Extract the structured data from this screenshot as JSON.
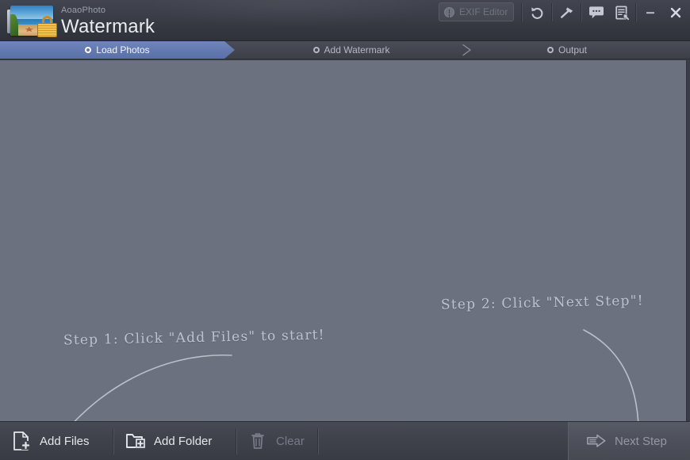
{
  "app": {
    "brand_small": "AoaoPhoto",
    "brand_big": "Watermark",
    "logo_icon": "photo-with-padlock-logo"
  },
  "titlebar": {
    "exif_button": {
      "label": "EXIF Editor",
      "icon": "exclamation-circle-icon",
      "enabled": false
    },
    "tools": [
      {
        "name": "undo-icon",
        "tooltip": "Undo"
      },
      {
        "name": "tools-hammer-icon",
        "tooltip": "Tools"
      },
      {
        "name": "feedback-bubble-icon",
        "tooltip": "Feedback"
      },
      {
        "name": "register-document-icon",
        "tooltip": "Register"
      }
    ],
    "window_controls": [
      {
        "name": "minimize-icon",
        "glyph": "minimize"
      },
      {
        "name": "close-icon",
        "glyph": "close"
      }
    ]
  },
  "steps": {
    "active_index": 0,
    "items": [
      {
        "label": "Load Photos",
        "state": "active"
      },
      {
        "label": "Add Watermark",
        "state": "inactive"
      },
      {
        "label": "Output",
        "state": "inactive"
      }
    ]
  },
  "canvas": {
    "background_color": "#6c7180",
    "annotations": [
      {
        "id": "step1",
        "text": "Step 1: Click \"Add Files\" to start!",
        "arrow": "curved-arrow-down-left"
      },
      {
        "id": "step2",
        "text": "Step 2: Click \"Next Step\"!",
        "arrow": "curved-arrow-down-right"
      }
    ],
    "empty": true
  },
  "bottombar": {
    "buttons": [
      {
        "label": "Add Files",
        "icon": "file-add-icon",
        "enabled": true
      },
      {
        "label": "Add Folder",
        "icon": "folder-add-icon",
        "enabled": true
      },
      {
        "label": "Clear",
        "icon": "trash-icon",
        "enabled": false
      }
    ],
    "next_step": {
      "label": "Next Step",
      "icon": "arrow-right-icon",
      "enabled": false
    }
  },
  "colors": {
    "accent_blue": "#6379b0",
    "chrome_dark": "#3a3d46",
    "canvas_grey": "#6c7180",
    "text_primary": "#e4e7ec",
    "text_disabled": "#767b86"
  }
}
